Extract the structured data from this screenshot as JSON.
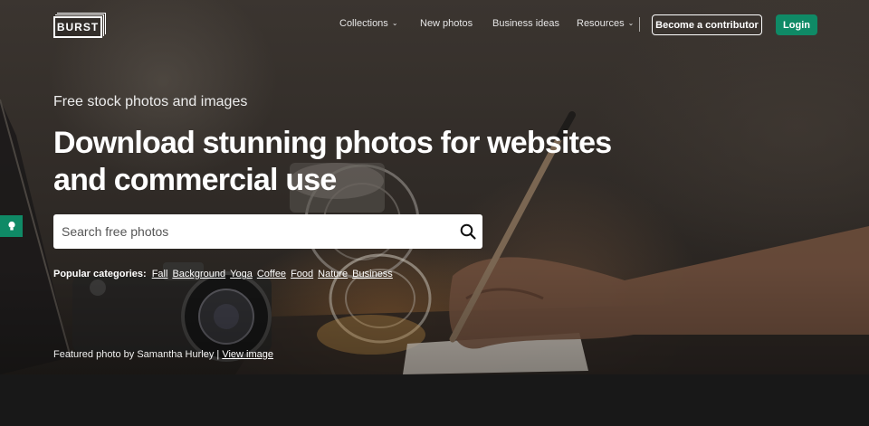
{
  "nav": {
    "logo": "BURST",
    "links": [
      {
        "label": "Collections",
        "has_dropdown": true
      },
      {
        "label": "New photos",
        "has_dropdown": false
      },
      {
        "label": "Business ideas",
        "has_dropdown": false
      },
      {
        "label": "Resources",
        "has_dropdown": true
      }
    ],
    "contributor_button": "Become a contributor",
    "login_button": "Login"
  },
  "hero": {
    "subtitle": "Free stock photos and images",
    "headline": "Download stunning photos for websites and commercial use",
    "search_placeholder": "Search free photos",
    "popular_label": "Popular categories:",
    "categories": [
      "Fall",
      "Background",
      "Yoga",
      "Coffee",
      "Food",
      "Nature",
      "Business"
    ],
    "featured_prefix": "Featured photo by Samantha Hurley |",
    "featured_link": "View image"
  },
  "icons": {
    "search": "search-icon",
    "chevron": "chevron-down-icon",
    "side_tab": "lightbulb-icon"
  },
  "colors": {
    "accent": "#0f8a66",
    "bottom_strip": "#181818"
  }
}
